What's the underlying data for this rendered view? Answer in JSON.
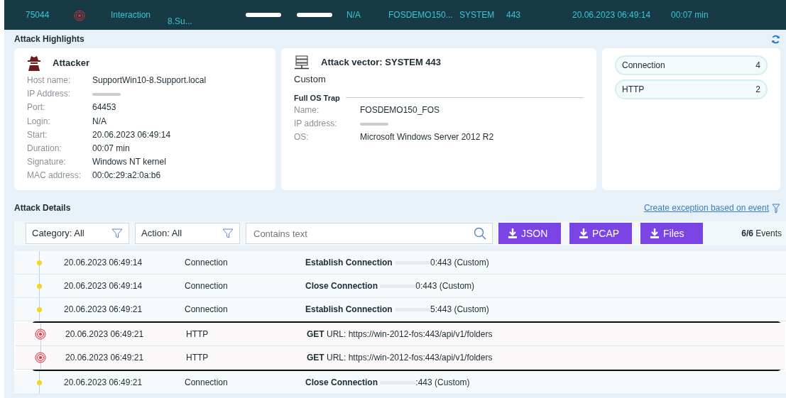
{
  "top_row": {
    "id": "75044",
    "type": "Interaction",
    "host": "8.Su...",
    "login": "N/A",
    "trap": "FOSDEMO150...",
    "vector": "SYSTEM",
    "port": "443",
    "start": "20.06.2023 06:49:14",
    "duration": "00:07 min"
  },
  "highlights": {
    "title": "Attack Highlights",
    "attacker": {
      "title": "Attacker",
      "fields": [
        {
          "label": "Host name:",
          "value": "SupportWin10-8.Support.local"
        },
        {
          "label": "IP Address:",
          "redacted": true
        },
        {
          "label": "Port:",
          "value": "64453"
        },
        {
          "label": "Login:",
          "value": "N/A"
        },
        {
          "label": "Start:",
          "value": "20.06.2023 06:49:14"
        },
        {
          "label": "Duration:",
          "value": "00:07 min"
        },
        {
          "label": "Signature:",
          "value": "Windows NT kernel"
        },
        {
          "label": "MAC address:",
          "value": "00:0c:29:a2:0a:b6"
        }
      ]
    },
    "vector": {
      "title": "Attack vector: SYSTEM 443",
      "subtitle": "Custom",
      "group": "Full OS Trap",
      "fields": [
        {
          "label": "Name:",
          "value": "FOSDEMO150_FOS"
        },
        {
          "label": "IP address:",
          "redacted": true
        },
        {
          "label": "OS:",
          "value": "Microsoft Windows Server 2012 R2"
        }
      ]
    },
    "categories": [
      {
        "name": "Connection",
        "count": "4"
      },
      {
        "name": "HTTP",
        "count": "2"
      }
    ]
  },
  "details": {
    "title": "Attack Details",
    "exception_link": "Create exception based on event",
    "filters": [
      {
        "label": "Category: All"
      },
      {
        "label": "Action: All"
      }
    ],
    "search": {
      "placeholder": "Contains text"
    },
    "buttons": [
      "JSON",
      "PCAP",
      "Files"
    ],
    "events_count": "6/6",
    "events_label": "Events",
    "rows": [
      {
        "kind": "dot",
        "highlighted": false,
        "time": "20.06.2023 06:49:14",
        "category": "Connection",
        "detail": "**Establish Connection** ",
        "detail_end": "0:443 (Custom)"
      },
      {
        "kind": "dot",
        "highlighted": false,
        "time": "20.06.2023 06:49:14",
        "category": "Connection",
        "detail": "**Close Connection** ",
        "detail_end": "0:443 (Custom)"
      },
      {
        "kind": "dot",
        "highlighted": false,
        "time": "20.06.2023 06:49:21",
        "category": "Connection",
        "detail": "**Establish Connection** ",
        "detail_end": "5:443 (Custom)"
      },
      {
        "kind": "alert",
        "highlighted": true,
        "time": "20.06.2023 06:49:21",
        "category": "HTTP",
        "detail": "**GET** URL: https://win-2012-fos:443/api/v1/folders"
      },
      {
        "kind": "alert",
        "highlighted": true,
        "time": "20.06.2023 06:49:21",
        "category": "HTTP",
        "detail": "**GET** URL: https://win-2012-fos:443/api/v1/folders"
      },
      {
        "kind": "dot",
        "highlighted": false,
        "time": "20.06.2023 06:49:21",
        "category": "Connection",
        "detail": "**Close Connection** ",
        "detail_end": ":443 (Custom)"
      }
    ]
  }
}
